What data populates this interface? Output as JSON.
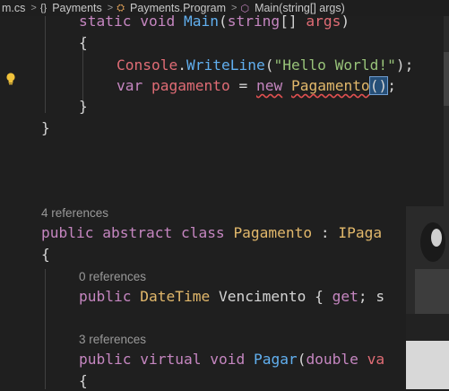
{
  "breadcrumb": [
    {
      "label": "m.cs",
      "icon": null
    },
    {
      "label": "Payments",
      "icon": "braces-icon"
    },
    {
      "label": "Payments.Program",
      "icon": "class-icon"
    },
    {
      "label": "Main(string[] args)",
      "icon": "method-icon"
    }
  ],
  "code": {
    "l1": [
      "static",
      "void",
      "Main",
      "(",
      "string",
      "[]",
      " args",
      ")"
    ],
    "l2": "{",
    "l3": {
      "obj": "Console",
      "dot": ".",
      "method": "WriteLine",
      "open": "(",
      "str": "\"Hello World!\"",
      "close": ");"
    },
    "l4": {
      "kw": "var",
      "name": "pagamento",
      "eq": " = ",
      "new": "new",
      "type": "Pagamento",
      "paren": "()",
      "end": ";"
    },
    "l5": "}",
    "l6": "}",
    "lens1": "4 references",
    "l7": {
      "public": "public",
      "abstract": "abstract",
      "class": "class",
      "name": "Pagamento",
      "colon": " : ",
      "iface": "IPaga"
    },
    "l8": "{",
    "lens2": "0 references",
    "l9": {
      "public": "public",
      "type": "DateTime",
      "name": "Vencimento",
      "rest1": " { ",
      "get": "get",
      "rest2": "; s"
    },
    "lens3": "3 references",
    "l10": {
      "public": "public",
      "virtual": "virtual",
      "void": "void",
      "method": "Pagar",
      "open": "(",
      "double": "double",
      "param": " va"
    },
    "l11": "{"
  }
}
